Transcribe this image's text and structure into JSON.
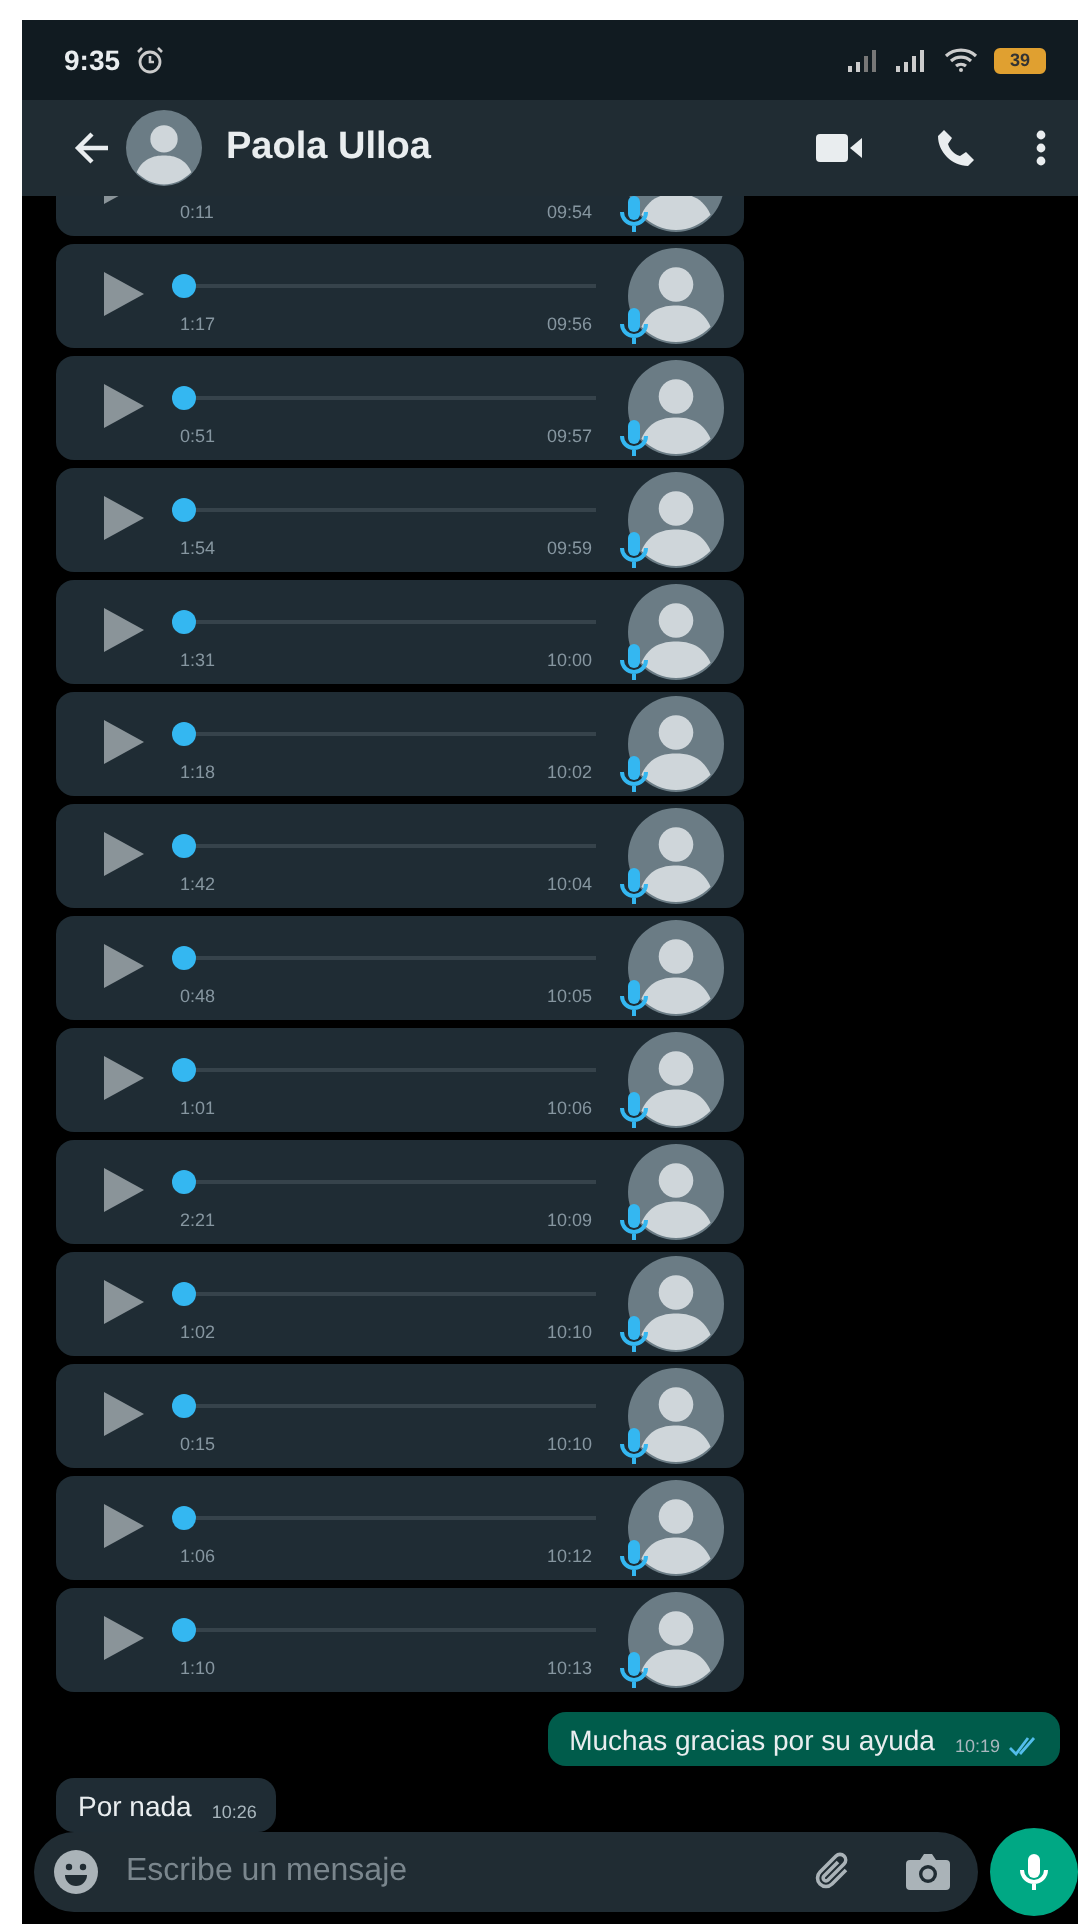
{
  "status_bar": {
    "time": "9:35",
    "battery": "39"
  },
  "header": {
    "contact_name": "Paola Ulloa"
  },
  "voice_notes": [
    {
      "duration": "0:11",
      "time": "09:54"
    },
    {
      "duration": "1:17",
      "time": "09:56",
      "level": 0
    },
    {
      "duration": "0:51",
      "time": "09:57",
      "level": 0
    },
    {
      "duration": "1:54",
      "time": "09:59",
      "level": 0
    },
    {
      "duration": "1:31",
      "time": "10:00",
      "level": 0
    },
    {
      "duration": "1:18",
      "time": "10:02",
      "level": 0
    },
    {
      "duration": "1:42",
      "time": "10:04",
      "level": 0
    },
    {
      "duration": "0:48",
      "time": "10:05",
      "level": 0
    },
    {
      "duration": "1:01",
      "time": "10:06",
      "level": 0
    },
    {
      "duration": "2:21",
      "time": "10:09",
      "level": 0
    },
    {
      "duration": "1:02",
      "time": "10:10",
      "level": 0
    },
    {
      "duration": "0:15",
      "time": "10:10",
      "level": 0
    },
    {
      "duration": "1:06",
      "time": "10:12",
      "level": 0
    },
    {
      "duration": "1:10",
      "time": "10:13",
      "level": 0
    }
  ],
  "messages": [
    {
      "kind": "outgoing",
      "text": "Muchas gracias por su ayuda",
      "time": "10:19",
      "read": true
    },
    {
      "kind": "incoming",
      "text": "Por nada",
      "time": "10:26"
    }
  ],
  "composer": {
    "placeholder": "Escribe un mensaje"
  }
}
